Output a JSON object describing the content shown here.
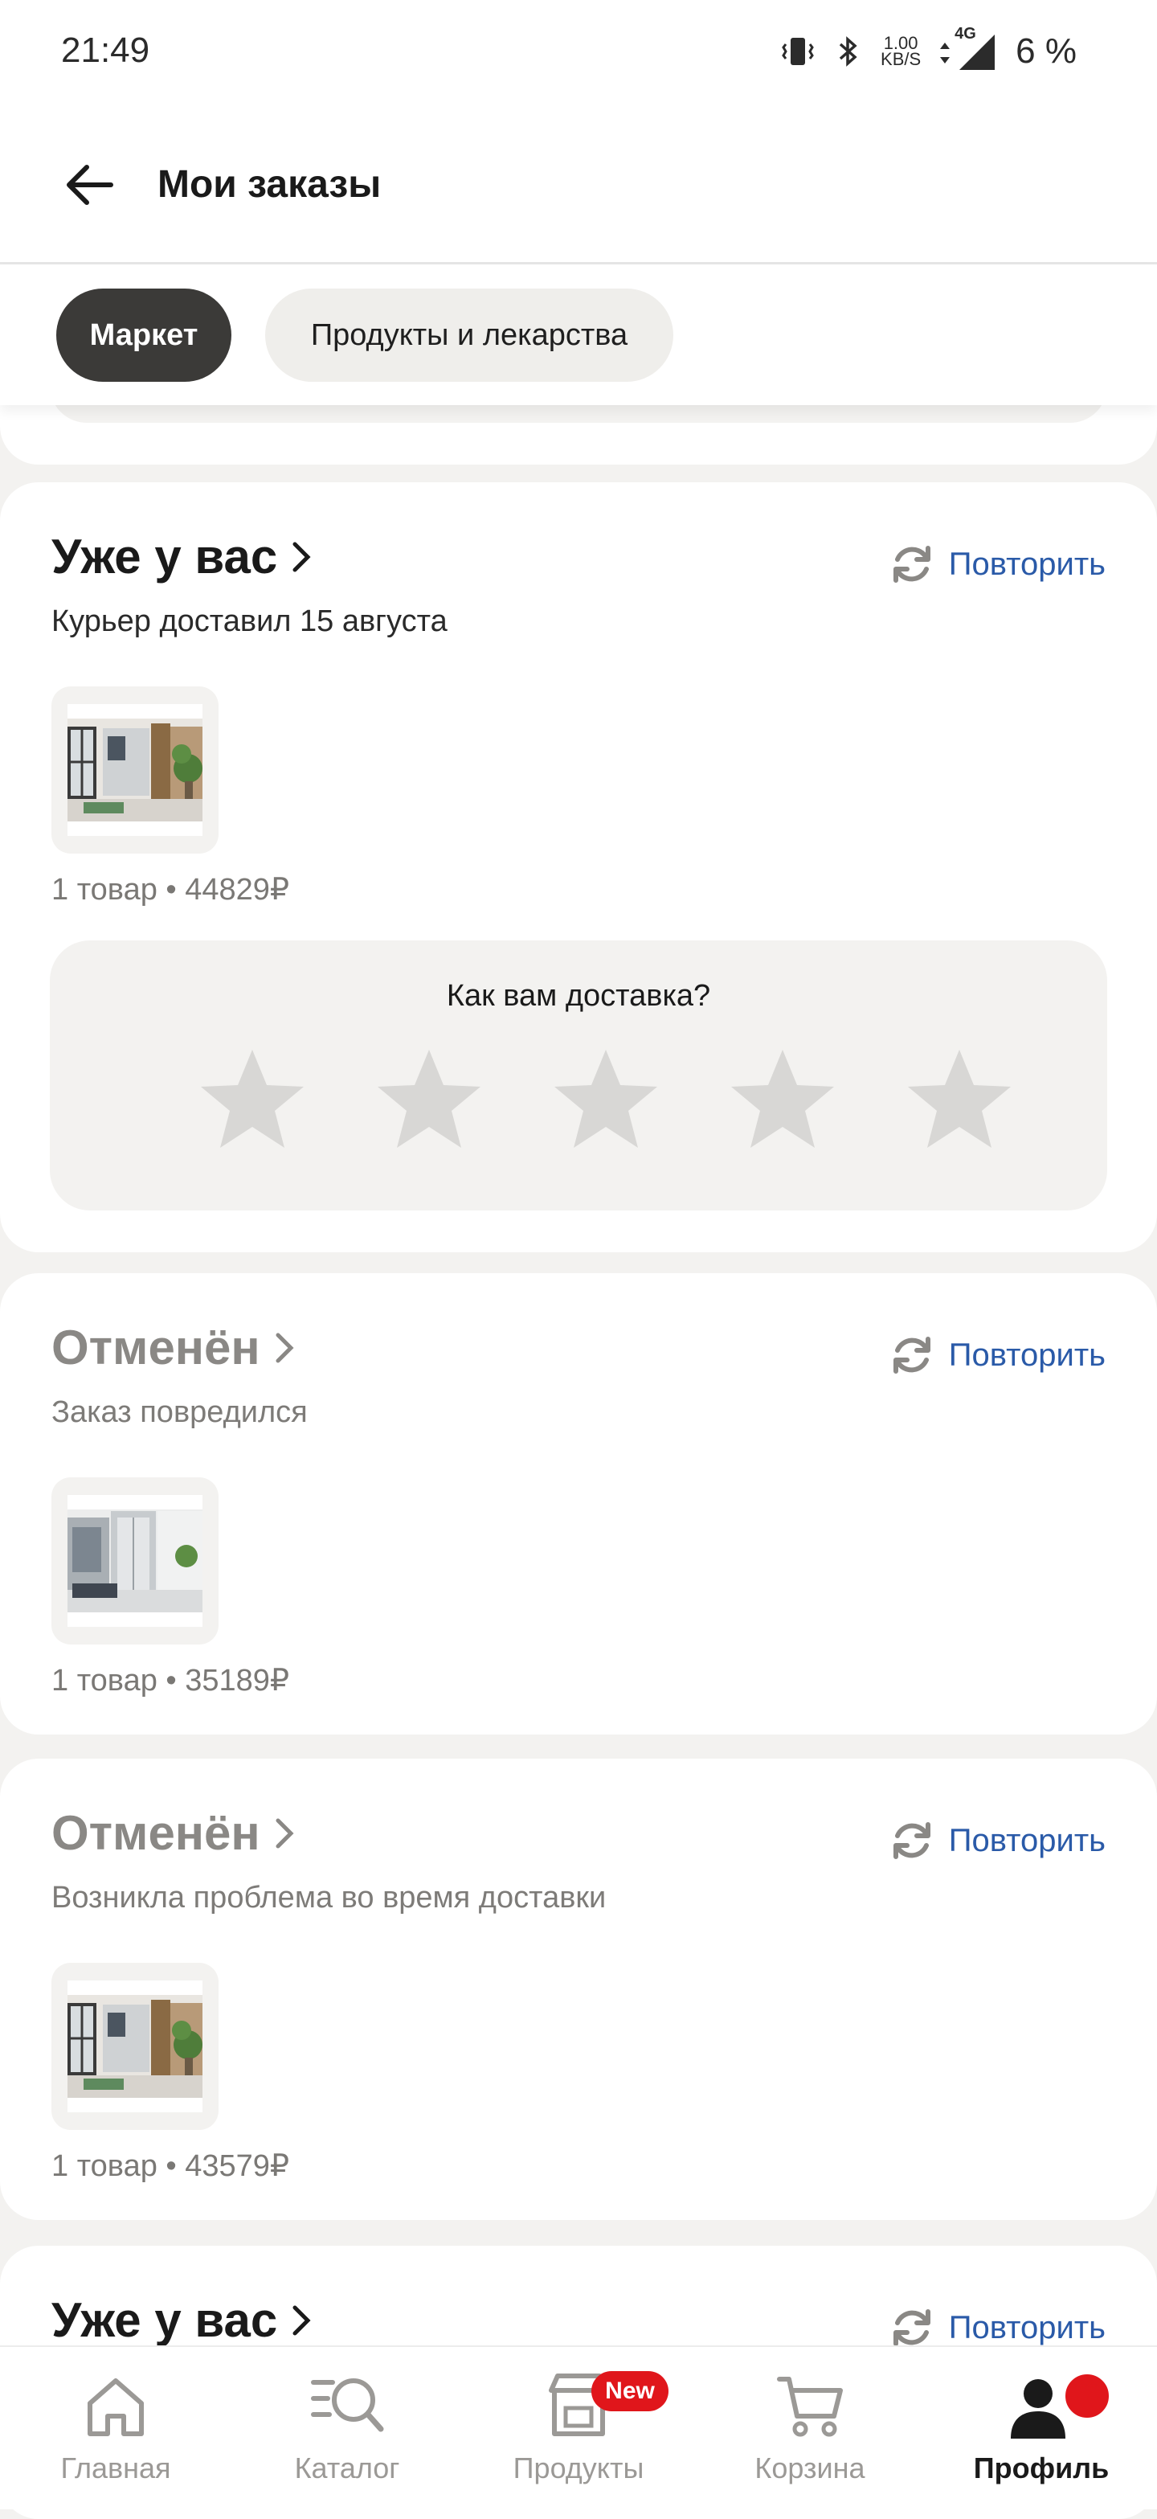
{
  "status_bar": {
    "time": "21:49",
    "net_speed_value": "1.00",
    "net_speed_unit": "KB/S",
    "network_type": "4G",
    "battery": "6 %"
  },
  "header": {
    "title": "Мои заказы"
  },
  "tabs": [
    {
      "label": "Маркет",
      "active": true
    },
    {
      "label": "Продукты и лекарства",
      "active": false
    }
  ],
  "orders": [
    {
      "status": "Уже у вас",
      "subtitle": "Курьер доставил 15 августа",
      "repeat_label": "Повторить",
      "summary": "1 товар • 44829₽",
      "rating": {
        "question": "Как вам доставка?",
        "stars_total": 5,
        "stars_selected": 0
      }
    },
    {
      "status": "Отменён",
      "subtitle": "Заказ повредился",
      "repeat_label": "Повторить",
      "summary": "1 товар • 35189₽"
    },
    {
      "status": "Отменён",
      "subtitle": "Возникла проблема во время доставки",
      "repeat_label": "Повторить",
      "summary": "1 товар • 43579₽"
    },
    {
      "status": "Уже у вас",
      "repeat_label": "Повторить"
    }
  ],
  "bottom_nav": [
    {
      "label": "Главная",
      "icon": "home-icon",
      "active": false
    },
    {
      "label": "Каталог",
      "icon": "catalog-search-icon",
      "active": false
    },
    {
      "label": "Продукты",
      "icon": "grocery-store-icon",
      "active": false,
      "badge": "New"
    },
    {
      "label": "Корзина",
      "icon": "cart-icon",
      "active": false
    },
    {
      "label": "Профиль",
      "icon": "profile-icon",
      "active": true
    }
  ],
  "colors": {
    "accent_link": "#2a5aa8",
    "badge_red": "#e0161b",
    "chip_active": "#3b3a38",
    "page_bg": "#f3f2f0"
  }
}
